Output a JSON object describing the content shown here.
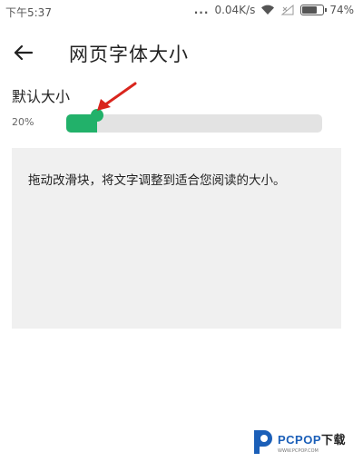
{
  "status_bar": {
    "time": "下午5:37",
    "network_speed": "0.04K/s",
    "battery_percent": "74%",
    "battery_level": 0.74,
    "icons": [
      "wifi-icon",
      "signal-icon",
      "battery-icon"
    ]
  },
  "app_bar": {
    "back_icon": "arrow-left-icon",
    "title": "网页字体大小"
  },
  "font_size": {
    "label": "默认大小",
    "percent_text": "20%",
    "slider_value": 0.12,
    "accent_color": "#22b16a",
    "track_color": "#e3e3e3"
  },
  "preview": {
    "text": "拖动改滑块，将文字调整到适合您阅读的大小。",
    "background": "#f0f0f0"
  },
  "annotation": {
    "icon": "red-arrow-icon",
    "color": "#d9251d"
  },
  "watermark": {
    "brand": "PCPOP",
    "suffix": "下载",
    "tagline": "WWW.PCPOP.COM"
  }
}
